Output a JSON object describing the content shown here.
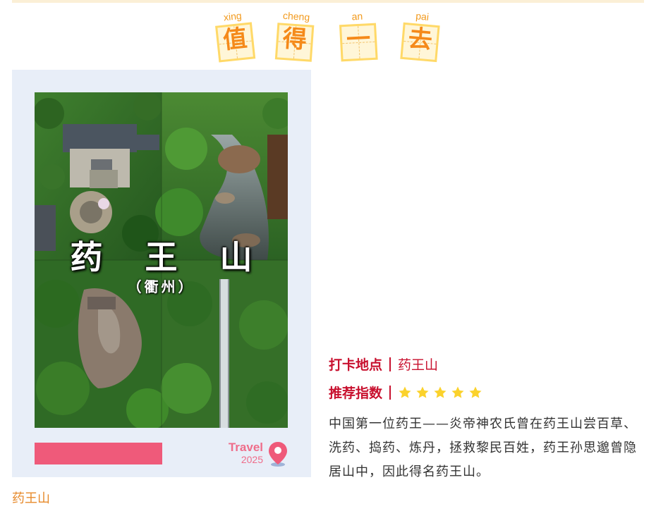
{
  "title_tiles": [
    {
      "pinyin": "xing",
      "char": "值"
    },
    {
      "pinyin": "cheng",
      "char": "得"
    },
    {
      "pinyin": "an",
      "char": "一"
    },
    {
      "pinyin": "pai",
      "char": "去"
    }
  ],
  "poster": {
    "title": "药 王 山",
    "subtitle": "（衢州）",
    "travel": "Travel",
    "year": "2025"
  },
  "info": {
    "location_label": "打卡地点",
    "location_value": "药王山",
    "rating_label": "推荐指数",
    "rating_stars": 5,
    "star_color": "#fbd22c",
    "description": "中国第一位药王——炎帝神农氏曾在药王山尝百草、洗药、捣药、炼丹，拯救黎民百姓，药王孙思邈曾隐居山中，因此得名药王山。"
  },
  "caption": "药王山",
  "colors": {
    "accent_red": "#c8102e",
    "title_orange": "#f58a1a",
    "pink": "#ef5a7a",
    "card_bg": "#e8eef8"
  }
}
